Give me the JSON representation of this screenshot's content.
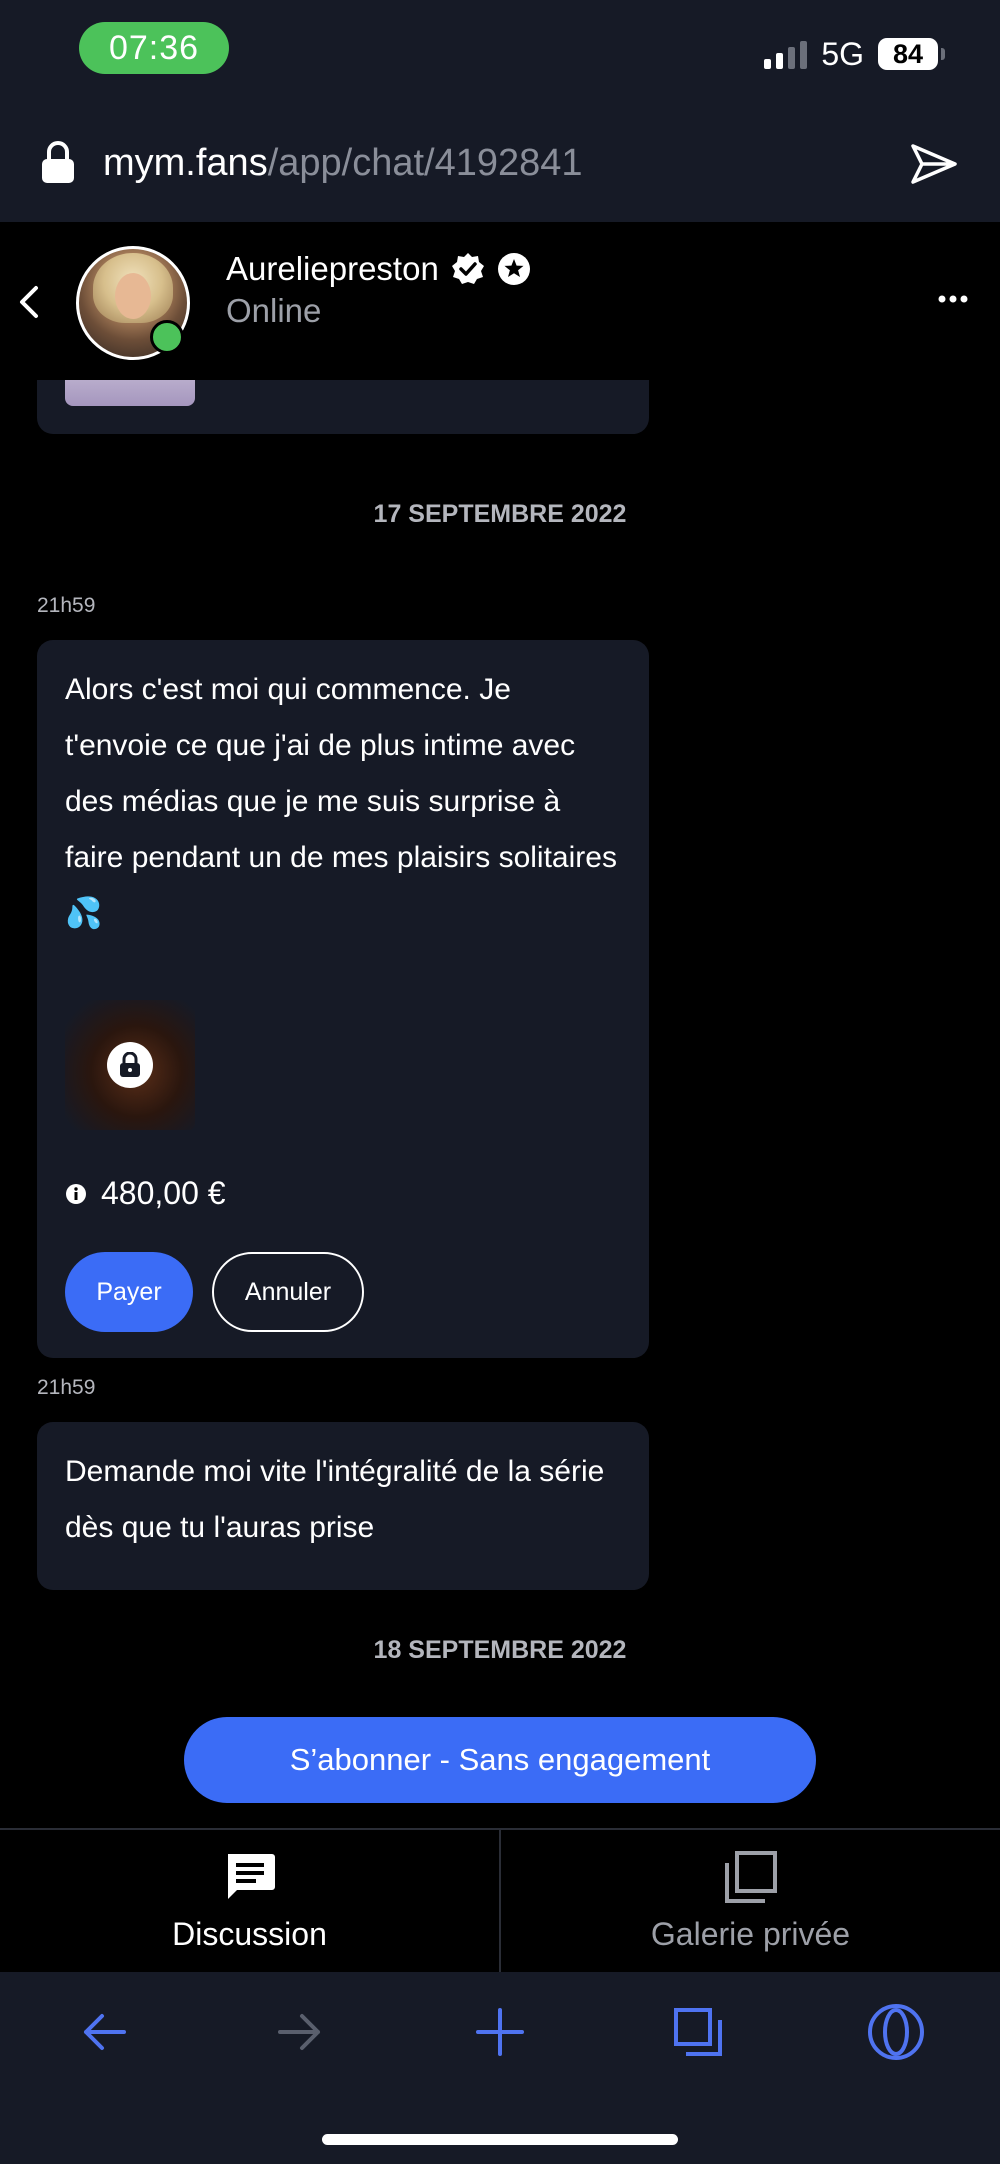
{
  "status_bar": {
    "time": "07:36",
    "network": "5G",
    "battery": "84"
  },
  "browser": {
    "url_host": "mym.fans",
    "url_path": "/app/chat/4192841"
  },
  "chat_header": {
    "name": "Aureliepreston",
    "presence": "Online"
  },
  "messages": {
    "date_1": "17 SEPTEMBRE 2022",
    "msg1_time": "21h59",
    "msg1_text": "Alors c'est moi qui commence. Je t'envoie ce que j'ai de plus intime avec des médias que je me suis surprise à faire pendant un de mes plaisirs solitaires 💦",
    "msg1_price": "480,00 €",
    "pay_label": "Payer",
    "cancel_label": "Annuler",
    "msg2_time": "21h59",
    "msg2_text": "Demande moi vite l'intégralité de la série dès que tu l'auras prise",
    "date_2": "18 SEPTEMBRE 2022"
  },
  "subscribe": {
    "label": "S’abonner - Sans engagement"
  },
  "tabs": {
    "discussion": "Discussion",
    "gallery": "Galerie privée"
  },
  "colors": {
    "accent": "#3b6cf6",
    "online": "#4cc25a",
    "bubble": "#161a26"
  }
}
